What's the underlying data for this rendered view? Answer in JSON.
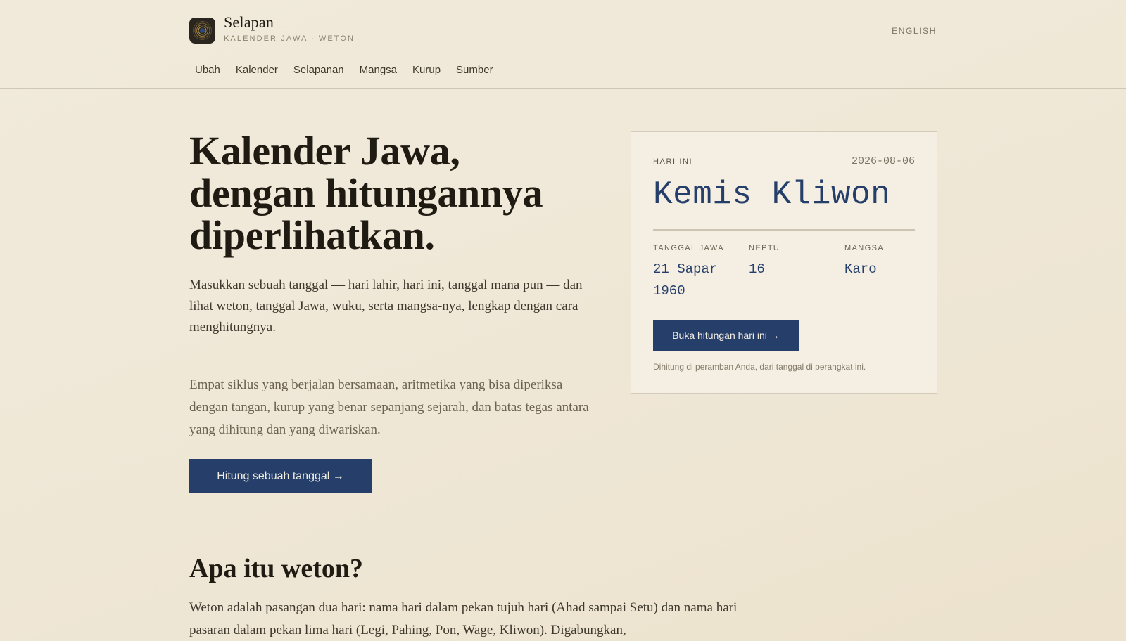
{
  "brand": {
    "name": "Selapan",
    "subtitle": "KALENDER JAWA · WETON",
    "logo_icon": "concentric-circles-icon"
  },
  "language_link": "ENGLISH",
  "nav": {
    "items": [
      "Ubah",
      "Kalender",
      "Selapanan",
      "Mangsa",
      "Kurup",
      "Sumber"
    ]
  },
  "hero": {
    "title_lines": [
      "Kalender Jawa,",
      "dengan hitungannya",
      "diperlihatkan."
    ],
    "lead": "Masukkan sebuah tanggal — hari lahir, hari ini, tanggal mana pun — dan lihat weton, tanggal Jawa, wuku, serta mangsa-nya, lengkap dengan cara menghitungnya.",
    "body": "Empat siklus yang berjalan bersamaan, aritmetika yang bisa diperiksa dengan tangan, kurup yang benar sepanjang sejarah, dan batas tegas antara yang dihitung dan yang diwariskan.",
    "cta_label": "Hitung sebuah tanggal →"
  },
  "today_card": {
    "label": "HARI INI",
    "date": "2026-08-06",
    "weton": "Kemis Kliwon",
    "stats": [
      {
        "label": "TANGGAL JAWA",
        "value": "21 Sapar 1960"
      },
      {
        "label": "NEPTU",
        "value": "16"
      },
      {
        "label": "MANGSA",
        "value": "Karo"
      }
    ],
    "button_label": "Buka hitungan hari ini →",
    "note": "Dihitung di peramban Anda, dari tanggal di perangkat ini."
  },
  "section": {
    "title": "Apa itu weton?",
    "body": "Weton adalah pasangan dua hari: nama hari dalam pekan tujuh hari (Ahad sampai Setu) dan nama hari pasaran dalam pekan lima hari (Legi, Pahing, Pon, Wage, Kliwon). Digabungkan,"
  },
  "colors": {
    "accent": "#263f6a",
    "background": "#f1eadb",
    "text": "#221d15"
  }
}
